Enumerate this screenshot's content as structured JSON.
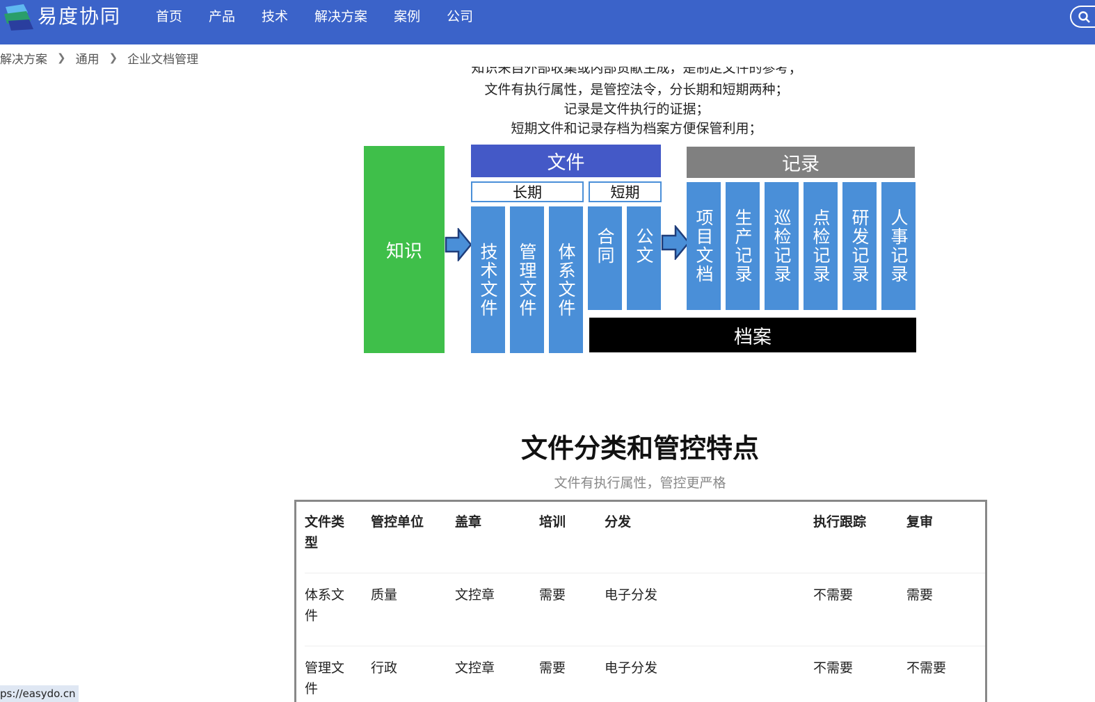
{
  "site": {
    "name": "易度协同",
    "nav": [
      "首页",
      "产品",
      "技术",
      "解决方案",
      "案例",
      "公司"
    ]
  },
  "breadcrumb": [
    "解决方案",
    "通用",
    "企业文档管理"
  ],
  "intro": {
    "partial_line": "知识来自外部收集或内部贡献生成，是制定文件的参考；",
    "lines": [
      "文件有执行属性，是管控法令，分长期和短期两种；",
      "记录是文件执行的证据；",
      "短期文件和记录存档为档案方便保管利用；"
    ]
  },
  "diagram": {
    "knowledge": "知识",
    "file_header": "文件",
    "long_term": "长期",
    "short_term": "短期",
    "long_items": [
      "技术文件",
      "管理文件",
      "体系文件"
    ],
    "short_items": [
      "合同",
      "公文"
    ],
    "record_header": "记录",
    "record_items": [
      "项目文档",
      "生产记录",
      "巡检记录",
      "点检记录",
      "研发记录",
      "人事记录"
    ],
    "archive": "档案",
    "colors": {
      "green": "#3fbf4a",
      "file_header": "#4459c7",
      "blue": "#4a8fd8",
      "gray": "#808080",
      "black": "#000000"
    }
  },
  "section": {
    "title": "文件分类和管控特点",
    "subtitle": "文件有执行属性，管控更严格"
  },
  "table": {
    "headers": [
      "文件类型",
      "管控单位",
      "盖章",
      "培训",
      "分发",
      "执行跟踪",
      "复审"
    ],
    "rows": [
      [
        "体系文件",
        "质量",
        "文控章",
        "需要",
        "电子分发",
        "不需要",
        "需要"
      ],
      [
        "管理文件",
        "行政",
        "文控章",
        "需要",
        "电子分发",
        "不需要",
        "不需要"
      ]
    ]
  },
  "status_url": "ps://easydo.cn"
}
